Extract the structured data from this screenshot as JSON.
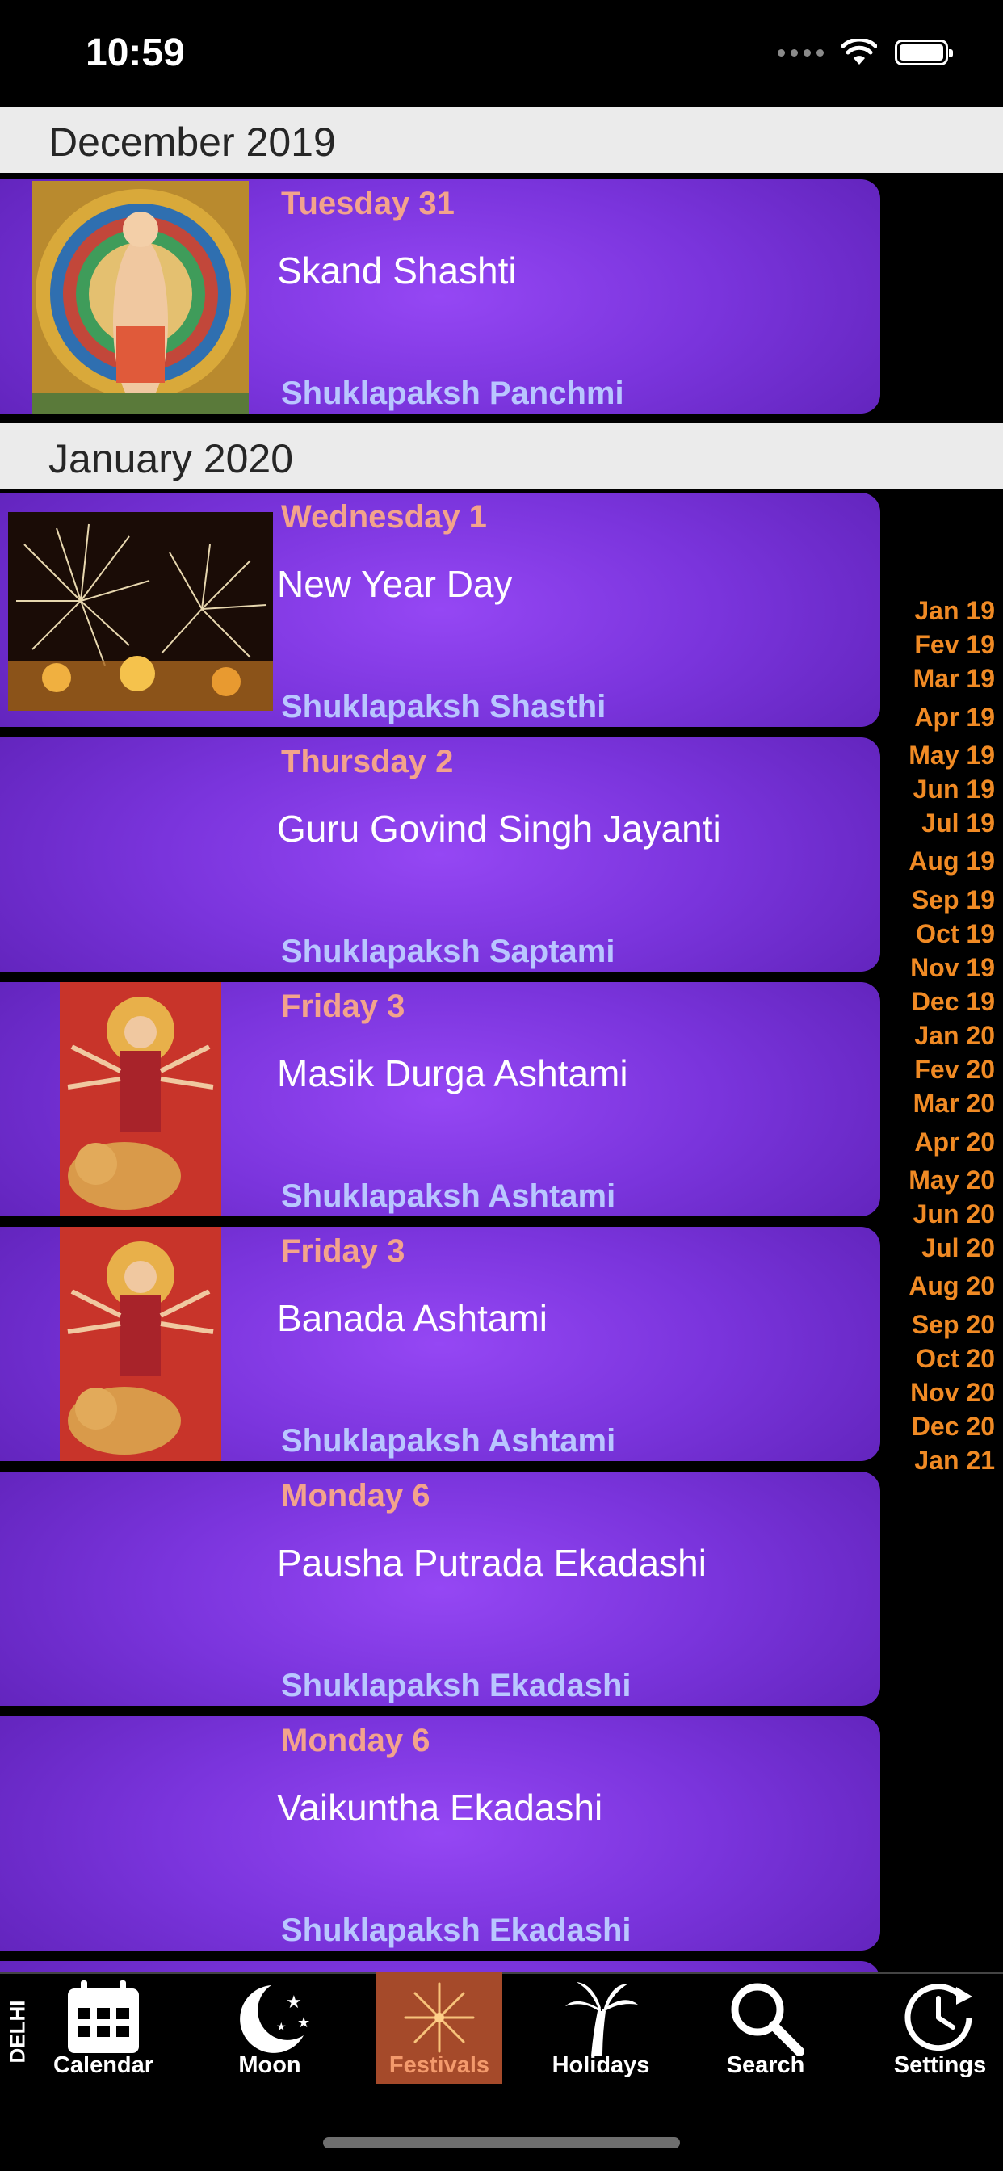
{
  "status_bar": {
    "time": "10:59"
  },
  "sections": [
    {
      "title": "December 2019"
    },
    {
      "title": "January 2020"
    }
  ],
  "events": [
    {
      "day": "Tuesday 31",
      "name": "Skand Shashti",
      "tithi": "Shuklapaksh Panchmi",
      "image": "murugan-deity"
    },
    {
      "day": "Wednesday 1",
      "name": "New Year Day",
      "tithi": "Shuklapaksh Shasthi",
      "image": "fireworks"
    },
    {
      "day": "Thursday 2",
      "name": "Guru Govind Singh Jayanti",
      "tithi": "Shuklapaksh Saptami",
      "image": ""
    },
    {
      "day": "Friday 3",
      "name": "Masik Durga Ashtami",
      "tithi": "Shuklapaksh Ashtami",
      "image": "durga-deity"
    },
    {
      "day": "Friday 3",
      "name": "Banada Ashtami",
      "tithi": "Shuklapaksh Ashtami",
      "image": "durga-deity"
    },
    {
      "day": "Monday 6",
      "name": "Pausha Putrada Ekadashi",
      "tithi": "Shuklapaksh Ekadashi",
      "image": ""
    },
    {
      "day": "Monday 6",
      "name": "Vaikuntha Ekadashi",
      "tithi": "Shuklapaksh Ekadashi",
      "image": ""
    }
  ],
  "month_index": [
    "Jan 19",
    "Fev 19",
    "Mar 19",
    "Apr 19",
    "May 19",
    "Jun 19",
    "Jul 19",
    "Aug 19",
    "Sep 19",
    "Oct 19",
    "Nov 19",
    "Dec 19",
    "Jan 20",
    "Fev 20",
    "Mar 20",
    "Apr 20",
    "May 20",
    "Jun 20",
    "Jul 20",
    "Aug 20",
    "Sep 20",
    "Oct 20",
    "Nov 20",
    "Dec 20",
    "Jan 21"
  ],
  "location": "DELHI",
  "tabs": [
    {
      "label": "Calendar",
      "icon": "calendar-icon"
    },
    {
      "label": "Moon",
      "icon": "moon-stars-icon"
    },
    {
      "label": "Festivals",
      "icon": "fireworks-icon",
      "active": true
    },
    {
      "label": "Holidays",
      "icon": "palm-tree-icon"
    },
    {
      "label": "Search",
      "icon": "search-icon"
    },
    {
      "label": "Settings",
      "icon": "clock-settings-icon"
    }
  ],
  "colors": {
    "card_purple": "#8a3ef0",
    "day_text": "#f3a38c",
    "tithi_text": "#b9c6ff",
    "index_text": "#f08a24",
    "active_tab": "#a54a2a"
  }
}
